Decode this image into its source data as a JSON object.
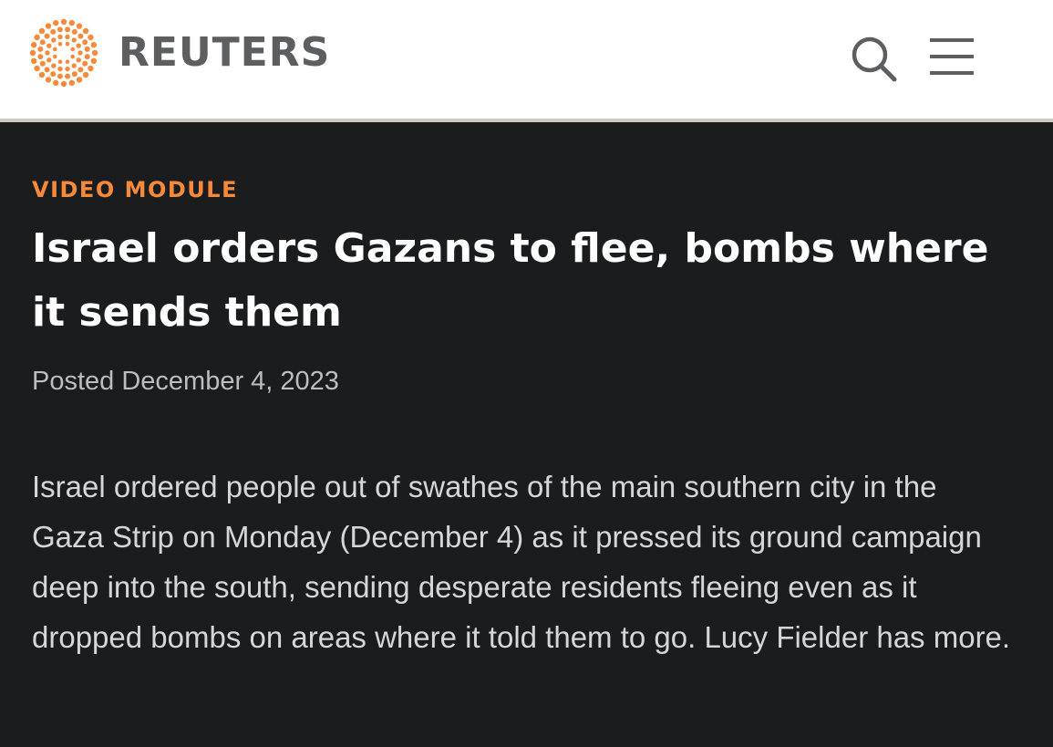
{
  "header": {
    "brand": "REUTERS",
    "brand_color": "#f58a3b",
    "logo_icon": "reuters-dot-sunburst-logo",
    "search_icon": "search-icon",
    "menu_icon": "hamburger-menu-icon"
  },
  "article": {
    "kicker": "VIDEO MODULE",
    "headline": "Israel orders Gazans to flee, bombs where it sends them",
    "posted": "Posted December 4, 2023",
    "summary": "Israel ordered people out of swathes of the main southern city in the Gaza Strip on Monday (December 4) as it pressed its ground campaign deep into the south, sending desperate residents fleeing even as it dropped bombs on areas where it told them to go. Lucy Fielder has more."
  }
}
